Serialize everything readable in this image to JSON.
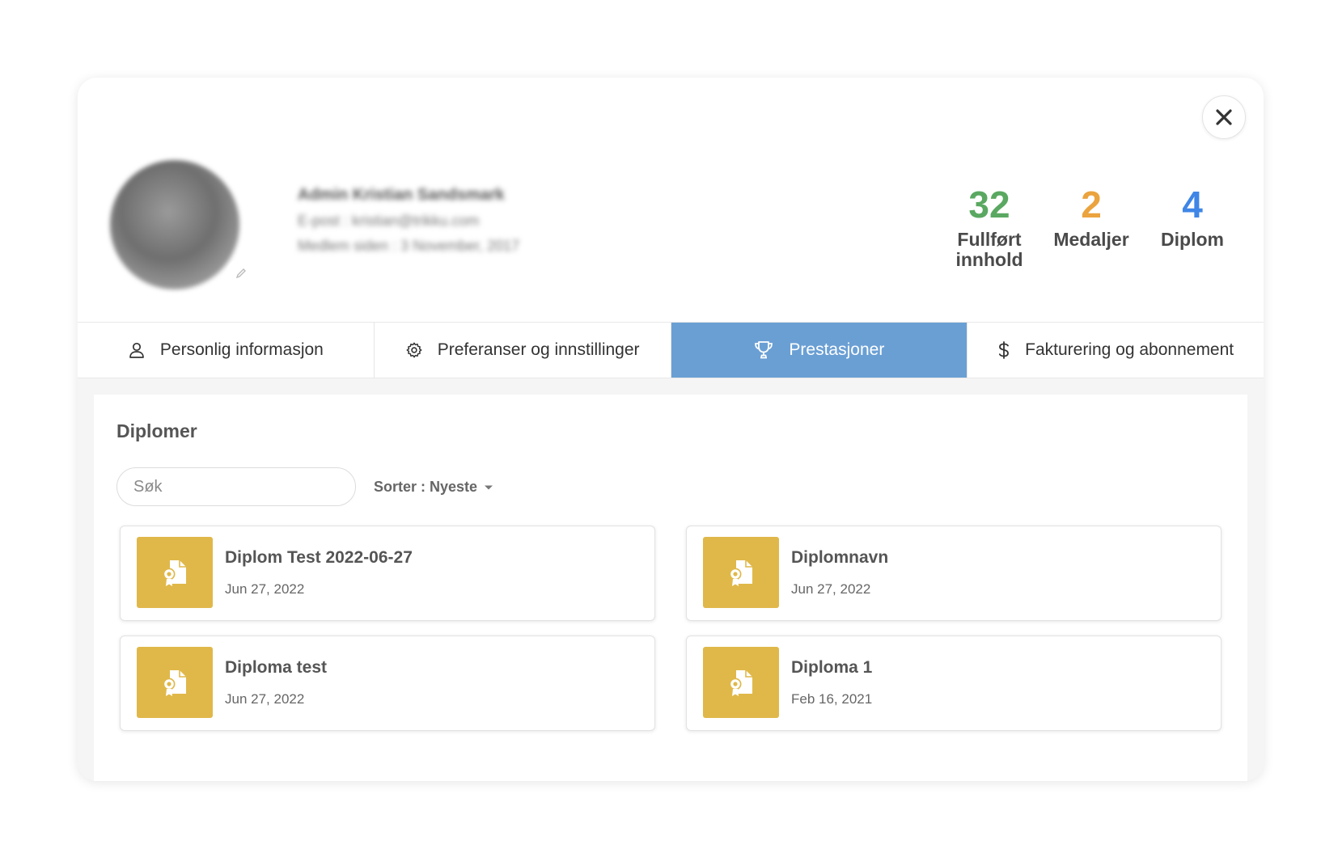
{
  "close_icon": "x-icon",
  "stats": [
    {
      "value": "32",
      "label": "Fullført innhold",
      "color": "#5aa861"
    },
    {
      "value": "2",
      "label": "Medaljer",
      "color": "#eba33e"
    },
    {
      "value": "4",
      "label": "Diplom",
      "color": "#3f86e6"
    }
  ],
  "tabs": [
    {
      "label": "Personlig informasjon",
      "icon": "user-icon"
    },
    {
      "label": "Preferanser og innstillinger",
      "icon": "gear-icon"
    },
    {
      "label": "Prestasjoner",
      "icon": "trophy-icon",
      "active": true
    },
    {
      "label": "Fakturering og abonnement",
      "icon": "dollar-icon"
    }
  ],
  "section": {
    "title": "Diplomer"
  },
  "search": {
    "placeholder": "Søk"
  },
  "sort": {
    "label": "Sorter : Nyeste"
  },
  "diplomas": [
    {
      "name": "Diplom Test 2022-06-27",
      "date": "Jun 27, 2022"
    },
    {
      "name": "Diplomnavn",
      "date": "Jun 27, 2022"
    },
    {
      "name": "Diploma test",
      "date": "Jun 27, 2022"
    },
    {
      "name": "Diploma 1",
      "date": "Feb 16, 2021"
    }
  ],
  "colors": {
    "accent": "#6a9fd4",
    "diploma_thumb": "#e0b84a"
  }
}
